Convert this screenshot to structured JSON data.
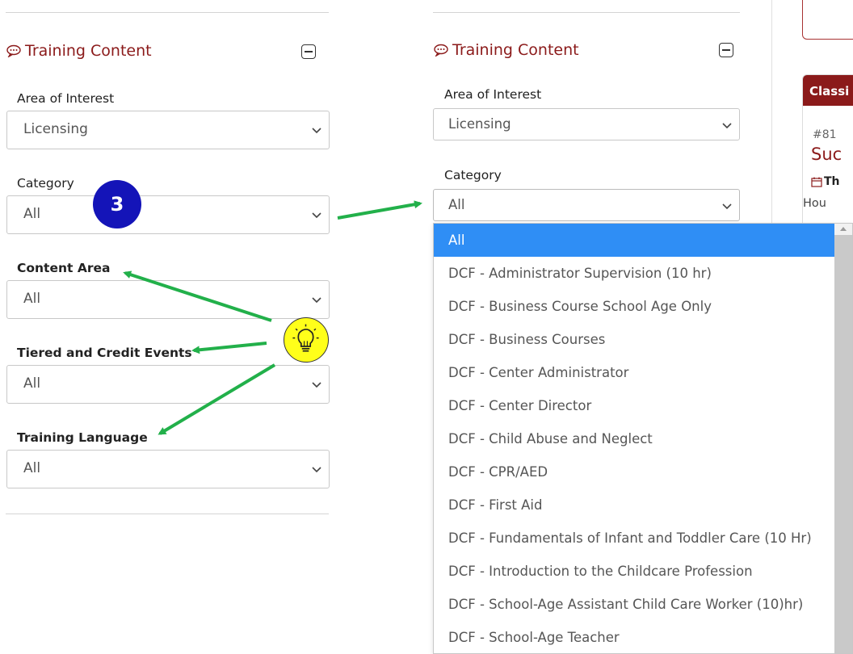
{
  "left_panel": {
    "section_title": "Training Content",
    "fields": [
      {
        "label": "Area of Interest",
        "value": "Licensing"
      },
      {
        "label": "Category",
        "value": "All"
      },
      {
        "label": "Content Area",
        "value": "All"
      },
      {
        "label": "Tiered and Credit Events",
        "value": "All"
      },
      {
        "label": "Training Language",
        "value": "All"
      }
    ]
  },
  "right_panel": {
    "section_title": "Training Content",
    "fields": [
      {
        "label": "Area of Interest",
        "value": "Licensing"
      },
      {
        "label": "Category",
        "value": "All"
      }
    ],
    "category_options": [
      "All",
      "DCF - Administrator Supervision (10 hr)",
      "DCF - Business Course School Age Only",
      "DCF - Business Courses",
      "DCF - Center Administrator",
      "DCF - Center Director",
      "DCF - Child Abuse and Neglect",
      "DCF - CPR/AED",
      "DCF - First Aid",
      "DCF - Fundamentals of Infant and Toddler Care (10 Hr)",
      "DCF - Introduction to the Childcare Profession",
      "DCF - School-Age Assistant Child Care Worker (10)hr)",
      "DCF - School-Age Teacher"
    ],
    "selected_option": "All"
  },
  "side_card": {
    "header": "Classi",
    "number": "#81",
    "title": "Suc",
    "date": "Th",
    "hours": "Hou"
  },
  "annotations": {
    "step_badge": "3",
    "arrow_color": "#22b04a",
    "badge_color": "#1414b8",
    "bulb_color": "#ffff1a",
    "icons": [
      "chat-bubble-icon",
      "collapse-icon",
      "chevron-down-icon",
      "lightbulb-icon",
      "calendar-icon"
    ]
  },
  "colors": {
    "title_red": "#8b1a1a",
    "selected_blue": "#2f8ef5"
  }
}
